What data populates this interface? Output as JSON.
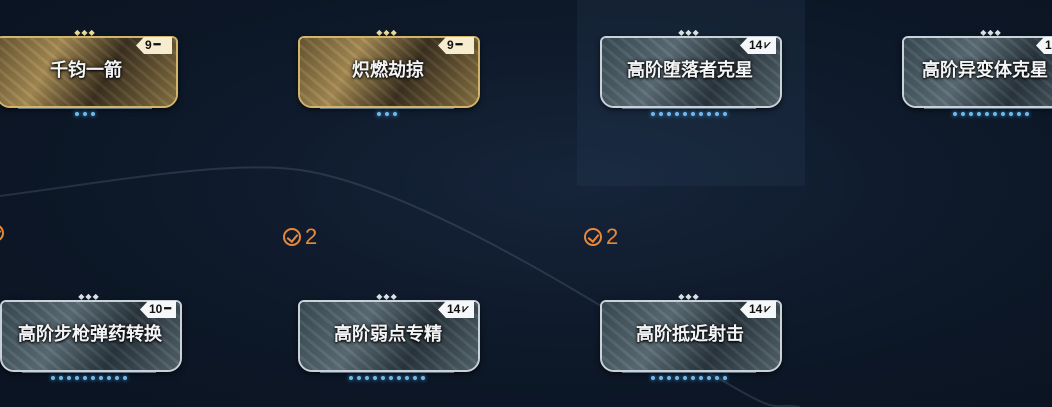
{
  "colors": {
    "accent_orange": "#e8893a",
    "gold_frame": "#d2b56a",
    "silver_frame": "#c9d2d8",
    "dot_blue": "#6fb9ea"
  },
  "row1": [
    {
      "name": "千钧一箭",
      "rank": "9",
      "polarity": "dash-icon",
      "tier": "gold",
      "dots": 3
    },
    {
      "name": "炽燃劫掠",
      "rank": "9",
      "polarity": "dash-icon",
      "tier": "gold",
      "dots": 3
    },
    {
      "name": "高阶堕落者克星",
      "rank": "14",
      "polarity": "v-icon",
      "tier": "silver",
      "dots": 10
    },
    {
      "name": "高阶异变体克星",
      "rank": "1",
      "polarity": "v-icon",
      "tier": "silver",
      "dots": 10
    }
  ],
  "counts": [
    {
      "value": "2"
    },
    {
      "value": "2"
    }
  ],
  "row2": [
    {
      "name": "高阶步枪弹药转换",
      "rank": "10",
      "polarity": "dash-icon",
      "tier": "silver",
      "dots": 10
    },
    {
      "name": "高阶弱点专精",
      "rank": "14",
      "polarity": "v-icon",
      "tier": "silver",
      "dots": 10
    },
    {
      "name": "高阶抵近射击",
      "rank": "14",
      "polarity": "v-icon",
      "tier": "silver",
      "dots": 10
    }
  ]
}
